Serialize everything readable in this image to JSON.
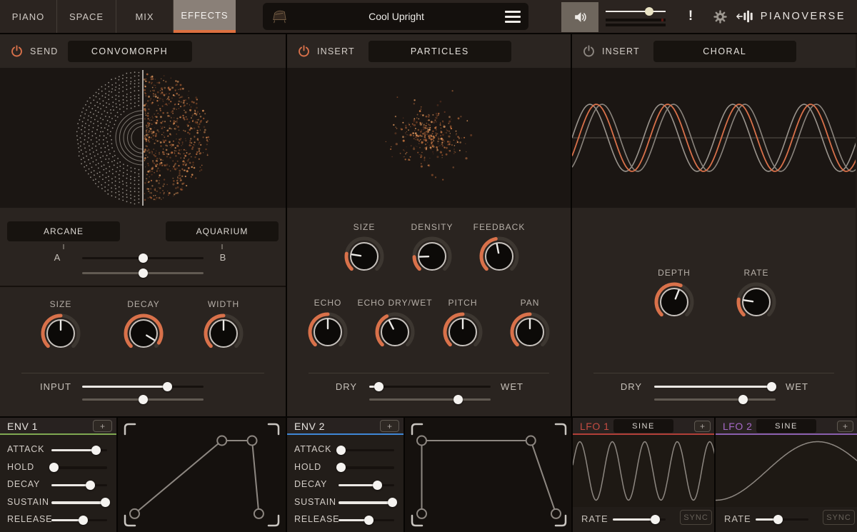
{
  "ui": {
    "plus": "+",
    "accent": "#d9714a"
  },
  "topbar": {
    "tabs": [
      {
        "label": "PIANO",
        "active": false
      },
      {
        "label": "SPACE",
        "active": false
      },
      {
        "label": "MIX",
        "active": false
      },
      {
        "label": "EFFECTS",
        "active": true
      }
    ],
    "preset_name": "Cool Upright",
    "alert_label": "!",
    "logo_text": "PIANOVERSE",
    "volume": 0.73
  },
  "effects": [
    {
      "id": "convomorph",
      "routing_label": "SEND",
      "name": "CONVOMORPH",
      "enabled": true,
      "ir_a": "ARCANE",
      "ir_b": "AQUARIUM",
      "morph_a_label": "A",
      "morph_b_label": "B",
      "morph_sliders": [
        0.5,
        0.5
      ],
      "knobs": [
        {
          "label": "SIZE",
          "value": 0.5
        },
        {
          "label": "DECAY",
          "value": 0.95
        },
        {
          "label": "WIDTH",
          "value": 0.5
        }
      ],
      "bottom_label": "INPUT",
      "bottom_sliders": [
        0.7,
        0.5
      ]
    },
    {
      "id": "particles",
      "routing_label": "INSERT",
      "name": "PARTICLES",
      "enabled": true,
      "knobs_row1": [
        {
          "label": "SIZE",
          "value": 0.2
        },
        {
          "label": "DENSITY",
          "value": 0.16
        },
        {
          "label": "FEEDBACK",
          "value": 0.46
        }
      ],
      "knobs_row2": [
        {
          "label": "ECHO",
          "value": 0.5
        },
        {
          "label": "ECHO DRY/WET",
          "value": 0.4
        },
        {
          "label": "PITCH",
          "value": 0.5
        },
        {
          "label": "PAN",
          "value": 0.5
        }
      ],
      "dry_label": "DRY",
      "wet_label": "WET",
      "mix_sliders": [
        0.08,
        0.73
      ]
    },
    {
      "id": "choral",
      "routing_label": "INSERT",
      "name": "CHORAL",
      "enabled": false,
      "knobs": [
        {
          "label": "DEPTH",
          "value": 0.58
        },
        {
          "label": "RATE",
          "value": 0.2
        }
      ],
      "dry_label": "DRY",
      "wet_label": "WET",
      "mix_sliders": [
        0.97,
        0.73
      ],
      "wave_cycles": 4,
      "wave_phases": [
        0,
        -1.07,
        -0.57
      ]
    }
  ],
  "modulators": [
    {
      "id": "env1",
      "title": "ENV 1",
      "accent": "#7fa851",
      "sliders": [
        {
          "label": "ATTACK",
          "value": 0.8
        },
        {
          "label": "HOLD",
          "value": 0.04
        },
        {
          "label": "DECAY",
          "value": 0.7
        },
        {
          "label": "SUSTAIN",
          "value": 0.97
        },
        {
          "label": "RELEASE",
          "value": 0.57
        }
      ],
      "shape": [
        [
          0.1,
          0.84
        ],
        [
          0.62,
          0.2
        ],
        [
          0.8,
          0.2
        ],
        [
          0.84,
          0.84
        ]
      ]
    },
    {
      "id": "env2",
      "title": "ENV 2",
      "accent": "#3f87d6",
      "sliders": [
        {
          "label": "ATTACK",
          "value": 0.04
        },
        {
          "label": "HOLD",
          "value": 0.04
        },
        {
          "label": "DECAY",
          "value": 0.7
        },
        {
          "label": "SUSTAIN",
          "value": 0.97
        },
        {
          "label": "RELEASE",
          "value": 0.55
        }
      ],
      "shape": [
        [
          0.1,
          0.84
        ],
        [
          0.1,
          0.2
        ],
        [
          0.75,
          0.2
        ],
        [
          0.9,
          0.84
        ]
      ]
    },
    {
      "id": "lfo1",
      "title": "LFO 1",
      "accent": "#c44c42",
      "underline": "#b23f38",
      "wave_label": "SINE",
      "rate_label": "RATE",
      "sync_label": "SYNC",
      "rate": 0.81,
      "wave_cycles": 4.4,
      "wave_phase": 0.2
    },
    {
      "id": "lfo2",
      "title": "LFO 2",
      "accent": "#a569c6",
      "underline": "#8a5fae",
      "wave_label": "SINE",
      "rate_label": "RATE",
      "sync_label": "SYNC",
      "rate": 0.42,
      "wave_cycles": 0.7,
      "wave_phase": -1.57
    }
  ]
}
